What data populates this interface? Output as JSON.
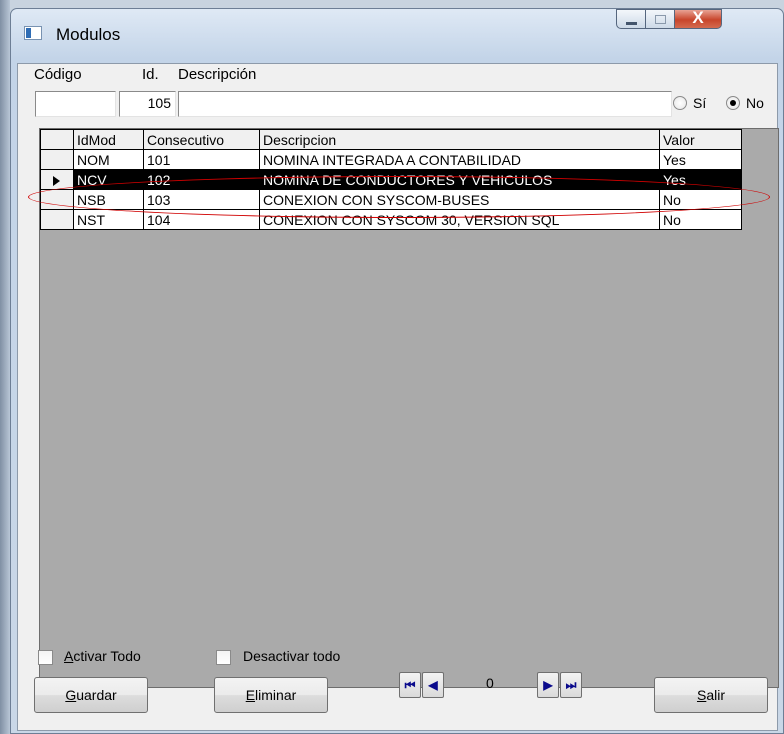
{
  "window": {
    "title": "Modulos",
    "close_glyph": "X"
  },
  "form": {
    "codigo_label": "Código",
    "id_label": "Id.",
    "descripcion_label": "Descripción",
    "codigo_value": "",
    "id_value": "105",
    "descripcion_value": "",
    "radio_si_label": "Sí",
    "radio_no_label": "No",
    "radio_selected": "No"
  },
  "grid": {
    "columns": [
      "IdMod",
      "Consecutivo",
      "Descripcion",
      "Valor"
    ],
    "rows": [
      {
        "idmod": "NOM",
        "consecutivo": "101",
        "descripcion": "NOMINA INTEGRADA A CONTABILIDAD",
        "valor": "Yes"
      },
      {
        "idmod": "NCV",
        "consecutivo": "102",
        "descripcion": "NOMINA DE CONDUCTORES Y VEHICULOS",
        "valor": "Yes"
      },
      {
        "idmod": "NSB",
        "consecutivo": "103",
        "descripcion": "CONEXION CON SYSCOM-BUSES",
        "valor": "No"
      },
      {
        "idmod": "NST",
        "consecutivo": "104",
        "descripcion": "CONEXION CON SYSCOM 30, VERSION SQL",
        "valor": "No"
      }
    ],
    "selected_row": 1
  },
  "checks": {
    "activar_prefix": "A",
    "activar_rest": "ctivar Todo",
    "desactivar_label": "Desactivar todo"
  },
  "buttons": {
    "guardar_prefix": "G",
    "guardar_rest": "uardar",
    "eliminar_prefix": "E",
    "eliminar_rest": "liminar",
    "salir_prefix": "S",
    "salir_rest": "alir"
  },
  "navigator": {
    "first_glyph": "⏮",
    "prev_glyph": "◀",
    "position": "0",
    "next_glyph": "▶",
    "last_glyph": "⏭"
  },
  "colors": {
    "selection": "#000000",
    "annotation": "#d00000",
    "nav_arrows": "#0a0a8c"
  }
}
